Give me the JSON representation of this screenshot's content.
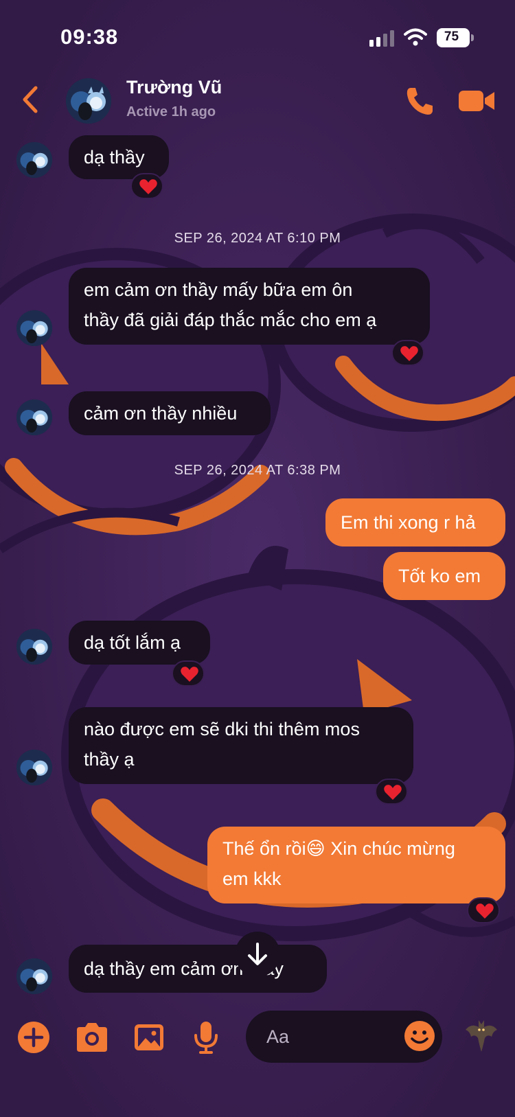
{
  "status_bar": {
    "time": "09:38",
    "battery": "75"
  },
  "header": {
    "contact_name": "Trường Vũ",
    "contact_status": "Active 1h ago"
  },
  "messages": [
    {
      "id": "m1",
      "side": "incoming",
      "text": "dạ thầy",
      "reaction": "heart"
    },
    {
      "id": "t1",
      "type": "timestamp",
      "text": "SEP 26, 2024 AT 6:10 PM"
    },
    {
      "id": "m2",
      "side": "incoming",
      "line1": "em cảm ơn thầy mấy bữa em ôn",
      "line2": "thầy đã giải đáp thắc mắc cho em ạ",
      "reaction": "heart"
    },
    {
      "id": "m3",
      "side": "incoming",
      "text": "cảm ơn thầy nhiều"
    },
    {
      "id": "t2",
      "type": "timestamp",
      "text": "SEP 26, 2024 AT 6:38 PM"
    },
    {
      "id": "m4",
      "side": "outgoing",
      "text": "Em thi xong r hả"
    },
    {
      "id": "m5",
      "side": "outgoing",
      "text": "Tốt ko em"
    },
    {
      "id": "m6",
      "side": "incoming",
      "text": "dạ tốt lắm ạ",
      "reaction": "heart"
    },
    {
      "id": "m7",
      "side": "incoming",
      "line1": "nào được em sẽ dki thi thêm mos",
      "line2": "thầy ạ",
      "reaction": "heart"
    },
    {
      "id": "m8",
      "side": "outgoing",
      "line1": "Thế ổn rồi😄 Xin chúc mừng",
      "line2": "em kkk",
      "reaction": "heart"
    },
    {
      "id": "m9",
      "side": "incoming",
      "text": "dạ thầy em cảm ơn thầy"
    }
  ],
  "composer": {
    "placeholder": "Aa"
  },
  "icons": {
    "back": "chevron-left-icon",
    "call": "phone-icon",
    "video": "video-camera-icon",
    "add": "plus-circle-icon",
    "camera": "camera-icon",
    "gallery": "image-icon",
    "mic": "microphone-icon",
    "emoji": "smiley-icon",
    "quick_reaction": "bat-icon",
    "scroll_down": "arrow-down-icon",
    "reaction": "heart-icon"
  },
  "colors": {
    "accent": "#f27a35",
    "background": "#3a1f52",
    "bubble_incoming": "#1a1020",
    "muted_text": "#a897b4"
  }
}
